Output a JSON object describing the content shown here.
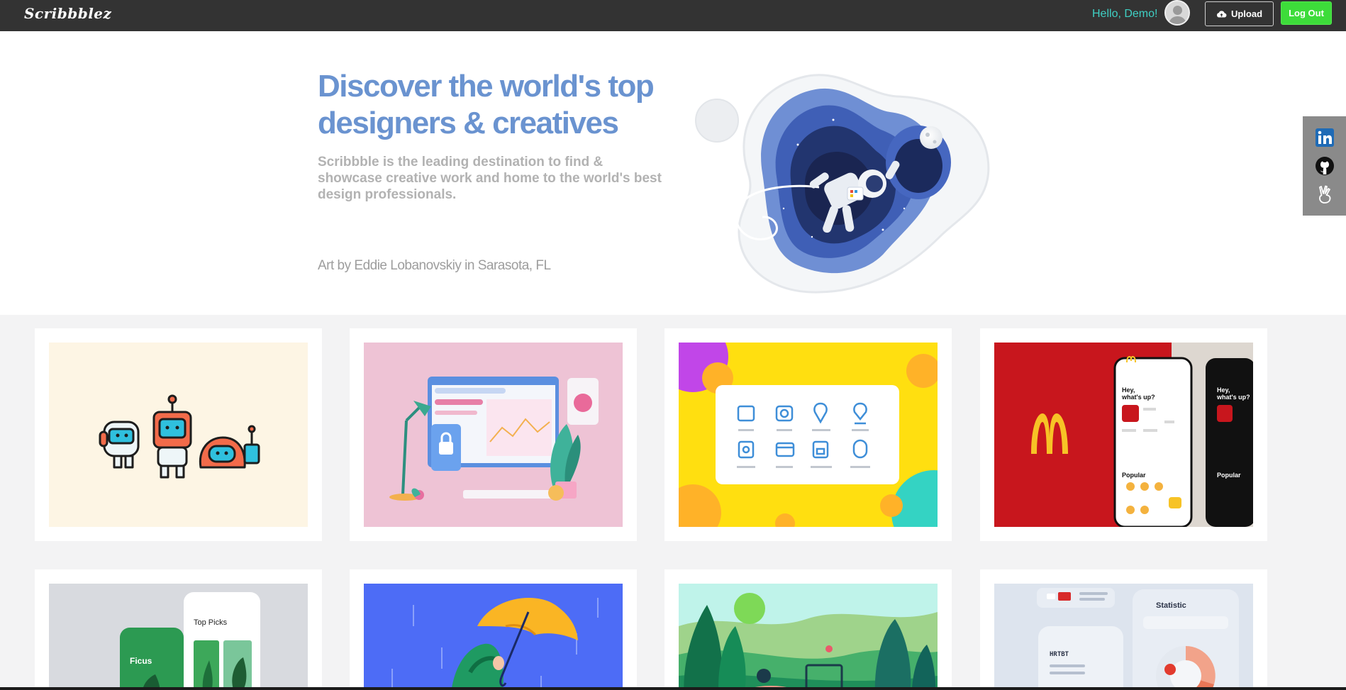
{
  "nav": {
    "logo": "Scribbblez",
    "greeting": "Hello, Demo!",
    "upload_label": "Upload",
    "logout_label": "Log Out",
    "accent_color": "#3fd0c4",
    "logout_color": "#3ddc3a"
  },
  "hero": {
    "title": "Discover the world's top designers & creatives",
    "subtitle": "Scribbble is the leading destination to find & showcase creative work and home to the world's best design professionals.",
    "credit": "Art by Eddie Lobanovskiy in Sarasota, FL",
    "title_color": "#6a93d0"
  },
  "social": [
    {
      "name": "linkedin-icon"
    },
    {
      "name": "github-icon"
    },
    {
      "name": "angellist-icon"
    }
  ],
  "gallery": {
    "shots": [
      {
        "name": "shot-robots"
      },
      {
        "name": "shot-desk-illustration"
      },
      {
        "name": "shot-icon-grid"
      },
      {
        "name": "shot-mcdonalds-app"
      },
      {
        "name": "shot-plant-shop-app"
      },
      {
        "name": "shot-umbrella-character"
      },
      {
        "name": "shot-forest-scene"
      },
      {
        "name": "shot-statistic-dashboard"
      }
    ],
    "text": {
      "hey": "Hey,",
      "whats_up": "what's up?",
      "popular": "Popular",
      "top_picks": "Top Picks",
      "ficus": "Ficus",
      "statistic": "Statistic",
      "hrtbt": "HRTBT"
    }
  }
}
